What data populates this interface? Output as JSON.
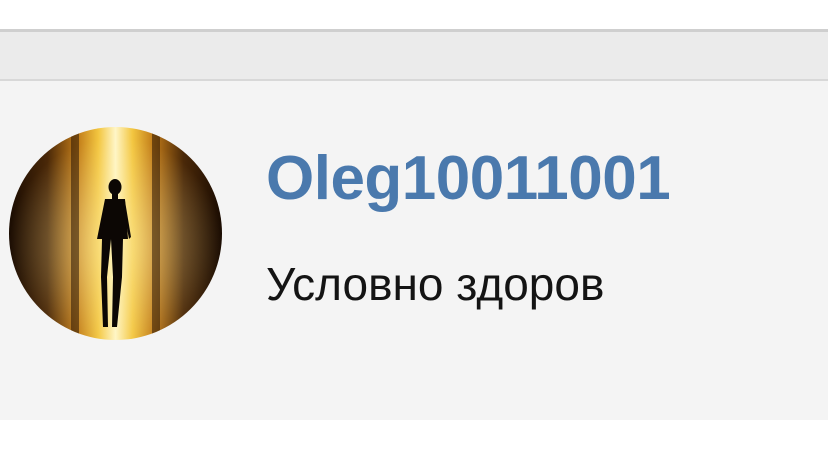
{
  "profile": {
    "username": "Oleg10011001",
    "status": "Условно здоров",
    "avatar_icon": "silhouette-avatar-icon"
  },
  "colors": {
    "username": "#4a79ad",
    "status_text": "#141414",
    "card_background": "#f4f4f4",
    "band_background": "#ebebeb"
  }
}
